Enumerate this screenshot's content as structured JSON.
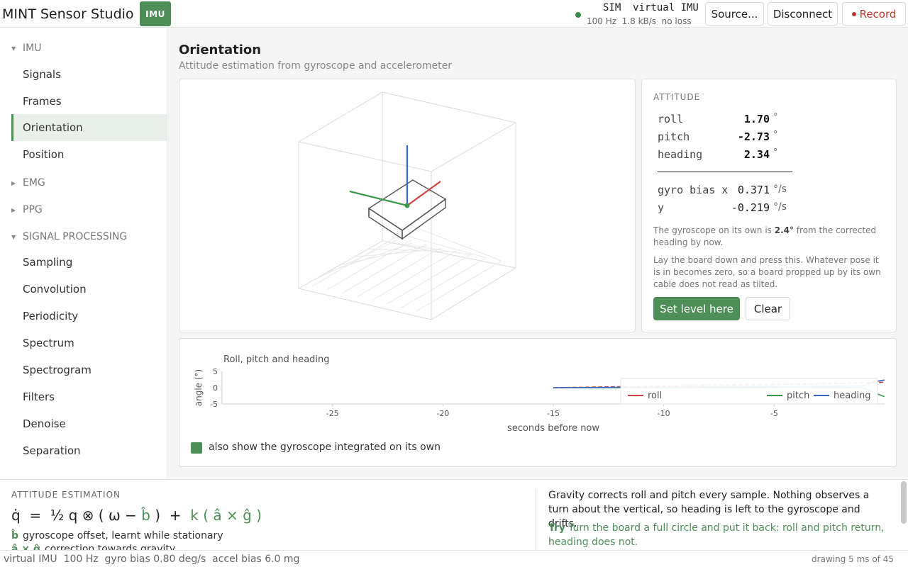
{
  "header": {
    "app_title": "MINT Sensor Studio",
    "badge": "IMU",
    "status_top": "SIM  virtual IMU",
    "status_bottom": "100 Hz  1.8 kB/s  no loss",
    "source_button": "Source...",
    "disconnect_button": "Disconnect",
    "record_button": "Record",
    "status_color": "#3a8a4c",
    "record_color": "#c0392b"
  },
  "sidebar": {
    "groups": {
      "imu": "IMU",
      "emg": "EMG",
      "ppg": "PPG",
      "signal_processing": "SIGNAL PROCESSING"
    },
    "imu_items": [
      "Signals",
      "Frames",
      "Orientation",
      "Position"
    ],
    "sp_items": [
      "Sampling",
      "Convolution",
      "Periodicity",
      "Spectrum",
      "Spectrogram",
      "Filters",
      "Denoise",
      "Separation"
    ],
    "active": "Orientation"
  },
  "main": {
    "title": "Orientation",
    "subtitle": "Attitude estimation from gyroscope and accelerometer"
  },
  "attitude": {
    "heading": "ATTITUDE",
    "roll_label": "roll",
    "roll_value": "1.70",
    "pitch_label": "pitch",
    "pitch_value": "-2.73",
    "heading_label": "heading",
    "heading_value": "2.34",
    "deg_unit": "°",
    "bias_x_label": "gyro bias x",
    "bias_x_value": "0.371",
    "bias_y_label": "y",
    "bias_y_value": "-0.219",
    "bias_unit": "°/s",
    "drift_pre": "The gyroscope on its own is ",
    "drift_value": "2.4°",
    "drift_post": " from the corrected heading by now.",
    "level_note": "Lay the board down and press this. Whatever pose it is in becomes zero, so a board propped up by its own cable does not read as tilted.",
    "level_button": "Set level here",
    "clear_button": "Clear"
  },
  "chart_data": {
    "type": "line",
    "title": "Roll, pitch and heading",
    "xlabel": "seconds before now",
    "ylabel": "angle (°)",
    "xlim": [
      -30,
      0
    ],
    "ylim": [
      -5,
      5
    ],
    "xticks": [
      "-25",
      "-20",
      "-15",
      "-10",
      "-5"
    ],
    "yticks": [
      "5",
      "0",
      "-5"
    ],
    "legend_position": "bottom-right",
    "series": [
      {
        "name": "roll",
        "color": "#d04040",
        "x": [
          -15.0,
          -12.0,
          -9.0,
          -6.0,
          -3.0,
          -1.5,
          -0.5,
          0.0
        ],
        "values": [
          0.0,
          0.3,
          0.6,
          0.9,
          1.2,
          1.4,
          1.6,
          1.7
        ]
      },
      {
        "name": "pitch",
        "color": "#3a9a4c",
        "x": [
          -15.0,
          -12.0,
          -9.0,
          -6.0,
          -3.0,
          -1.0,
          -0.5,
          0.0
        ],
        "values": [
          0.0,
          0.0,
          0.0,
          0.0,
          0.0,
          0.0,
          -1.5,
          -2.73
        ]
      },
      {
        "name": "heading",
        "color": "#3a64c8",
        "x": [
          -15.0,
          -12.0,
          -9.0,
          -6.0,
          -3.0,
          -1.0,
          -0.5,
          0.0
        ],
        "values": [
          0.0,
          0.1,
          0.2,
          0.3,
          0.4,
          0.5,
          1.8,
          2.34
        ]
      }
    ]
  },
  "gyro_option": "also show the gyroscope integrated on its own",
  "estimation": {
    "heading": "ATTITUDE ESTIMATION",
    "formula_main": "q̇  =  ½ q ⊗ ( ω − ",
    "formula_b": "b̂",
    "formula_mid": " )  +  ",
    "formula_k": "k ( â × ĝ )",
    "def_b_symbol": "b̂",
    "def_b_text": "gyroscope offset, learnt while stationary",
    "def_c_symbol": "â × ĝ",
    "def_c_text": "correction towards gravity",
    "explanation": "Gravity corrects roll and pitch every sample. Nothing observes a turn about the vertical, so heading is left to the gyroscope and drifts.",
    "try_label": "Try",
    "try_text": "Turn the board a full circle and put it back: roll and pitch return, heading does not."
  },
  "footer": {
    "left": "virtual IMU  100 Hz  gyro bias 0.80 deg/s  accel bias 6.0 mg",
    "right": "drawing 5 ms of 45"
  },
  "colors": {
    "accent": "#4e8f58",
    "active_bg": "#e8f1e9"
  }
}
